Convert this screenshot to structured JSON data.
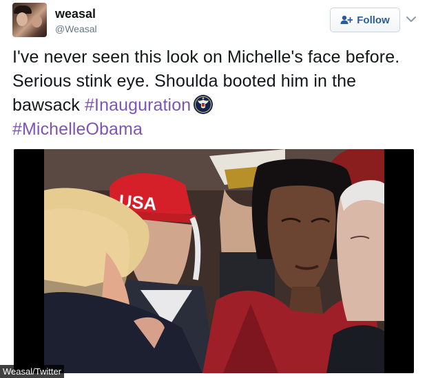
{
  "user": {
    "name": "weasal",
    "handle": "@Weasal"
  },
  "follow": {
    "label": "Follow"
  },
  "tweet": {
    "text_part1": "I've never seen this look on Michelle's face before. Serious stink eye. Shoulda booted him in the bawsack ",
    "hashtag1": "#Inauguration",
    "hashtag2": "#MichelleObama"
  },
  "media": {
    "hat_text": "USA",
    "watermark": "Weasal/Twitter"
  },
  "colors": {
    "hashtag": "#7e55b5",
    "follow_text": "#2a5c9a",
    "handle": "#657786"
  },
  "icons": {
    "follow": "add-user-icon",
    "menu": "chevron-down-icon",
    "hashflag": "presidential-seal-icon"
  }
}
